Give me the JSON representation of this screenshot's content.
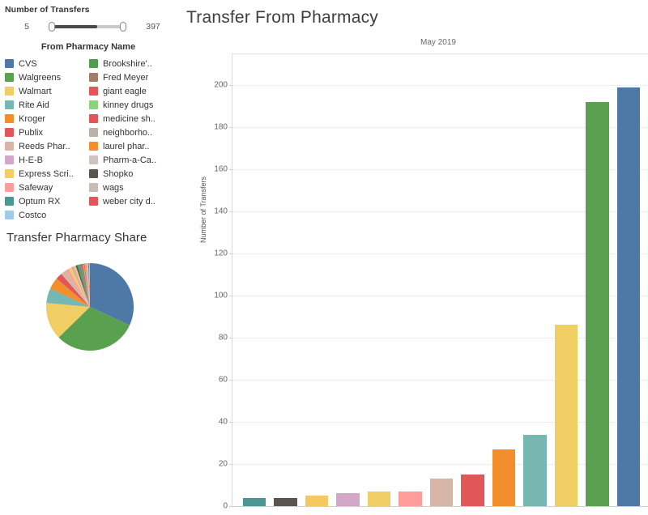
{
  "filter": {
    "title": "Number of Transfers",
    "min_label": "5",
    "max_label": "397"
  },
  "legend": {
    "title": "From Pharmacy Name",
    "column1": [
      {
        "label": "CVS",
        "color": "#4e79a7"
      },
      {
        "label": "Walgreens",
        "color": "#59a14f"
      },
      {
        "label": "Walmart",
        "color": "#f1ce63"
      },
      {
        "label": "Rite Aid",
        "color": "#76b7b2"
      },
      {
        "label": "Kroger",
        "color": "#f28e2b"
      },
      {
        "label": "Publix",
        "color": "#e15759"
      },
      {
        "label": "Reeds Phar..",
        "color": "#d7b5a6"
      },
      {
        "label": "H-E-B",
        "color": "#d4a6c8"
      },
      {
        "label": "Express Scri..",
        "color": "#f1ce63"
      },
      {
        "label": "Safeway",
        "color": "#ff9d9a"
      },
      {
        "label": "Optum RX",
        "color": "#499894"
      },
      {
        "label": "Costco",
        "color": "#a0cbe8"
      }
    ],
    "column2": [
      {
        "label": "Brookshire'..",
        "color": "#4e9e4e"
      },
      {
        "label": "Fred Meyer",
        "color": "#a17d6b"
      },
      {
        "label": "giant eagle",
        "color": "#e15759"
      },
      {
        "label": "kinney drugs",
        "color": "#8cd17d"
      },
      {
        "label": "medicine sh..",
        "color": "#e15759"
      },
      {
        "label": "neighborho..",
        "color": "#bab0ac"
      },
      {
        "label": "laurel phar..",
        "color": "#f28e2b"
      },
      {
        "label": "Pharm-a-Ca..",
        "color": "#cfc4bd"
      },
      {
        "label": "Shopko",
        "color": "#595651"
      },
      {
        "label": "wags",
        "color": "#c9bcb6"
      },
      {
        "label": "weber city d..",
        "color": "#e15759"
      }
    ]
  },
  "pie": {
    "title": "Transfer Pharmacy Share"
  },
  "chart": {
    "title": "Transfer From Pharmacy",
    "panel_label": "May 2019"
  },
  "chart_data": {
    "type": "bar",
    "title": "Transfer From Pharmacy",
    "subtitle": "May 2019",
    "xlabel": "",
    "ylabel": "Number of Transfers",
    "ylim": [
      0,
      210
    ],
    "yticks": [
      0,
      20,
      40,
      60,
      80,
      100,
      120,
      140,
      160,
      180,
      200
    ],
    "grid": true,
    "legend_position": "left",
    "categories": [
      "Optum RX",
      "Shopko",
      "Express Scripts",
      "H-E-B",
      "Walmart",
      "Safeway",
      "Reeds Pharmacy",
      "Publix",
      "Kroger",
      "Rite Aid",
      "Walmart",
      "Walgreens",
      "CVS"
    ],
    "values": [
      4,
      4,
      5,
      6,
      7,
      7,
      13,
      15,
      27,
      34,
      86,
      192,
      199
    ],
    "colors": [
      "#499894",
      "#595651",
      "#f6c860",
      "#d4a6c8",
      "#f1ce63",
      "#ff9d9a",
      "#d7b5a6",
      "#e15759",
      "#f28e2b",
      "#76b7b2",
      "#f1ce63",
      "#59a14f",
      "#4e79a7"
    ]
  },
  "pie_data": {
    "type": "pie",
    "title": "Transfer Pharmacy Share",
    "slices": [
      {
        "label": "CVS",
        "value": 199,
        "color": "#4e79a7"
      },
      {
        "label": "Walgreens",
        "value": 192,
        "color": "#59a14f"
      },
      {
        "label": "Walmart",
        "value": 86,
        "color": "#f1ce63"
      },
      {
        "label": "Rite Aid",
        "value": 34,
        "color": "#76b7b2"
      },
      {
        "label": "Kroger",
        "value": 27,
        "color": "#f28e2b"
      },
      {
        "label": "Publix",
        "value": 15,
        "color": "#e15759"
      },
      {
        "label": "Reeds Pharmacy",
        "value": 13,
        "color": "#d7b5a6"
      },
      {
        "label": "Safeway",
        "value": 7,
        "color": "#ff9d9a"
      },
      {
        "label": "Walmart",
        "value": 7,
        "color": "#f1ce63"
      },
      {
        "label": "H-E-B",
        "value": 6,
        "color": "#d4a6c8"
      },
      {
        "label": "Express Scripts",
        "value": 5,
        "color": "#f6c860"
      },
      {
        "label": "Shopko",
        "value": 4,
        "color": "#595651"
      },
      {
        "label": "Optum RX",
        "value": 4,
        "color": "#499894"
      },
      {
        "label": "Brookshire's",
        "value": 3,
        "color": "#4e9e4e"
      },
      {
        "label": "Fred Meyer",
        "value": 3,
        "color": "#a17d6b"
      },
      {
        "label": "giant eagle",
        "value": 3,
        "color": "#e15759"
      },
      {
        "label": "kinney drugs",
        "value": 2,
        "color": "#8cd17d"
      },
      {
        "label": "medicine shoppe",
        "value": 2,
        "color": "#e15759"
      },
      {
        "label": "neighborhood",
        "value": 2,
        "color": "#bab0ac"
      },
      {
        "label": "laurel pharmacy",
        "value": 2,
        "color": "#f28e2b"
      },
      {
        "label": "Pharm-a-Care",
        "value": 2,
        "color": "#cfc4bd"
      },
      {
        "label": "wags",
        "value": 2,
        "color": "#c9bcb6"
      },
      {
        "label": "weber city drug",
        "value": 2,
        "color": "#e15759"
      },
      {
        "label": "Costco",
        "value": 2,
        "color": "#a0cbe8"
      }
    ]
  }
}
